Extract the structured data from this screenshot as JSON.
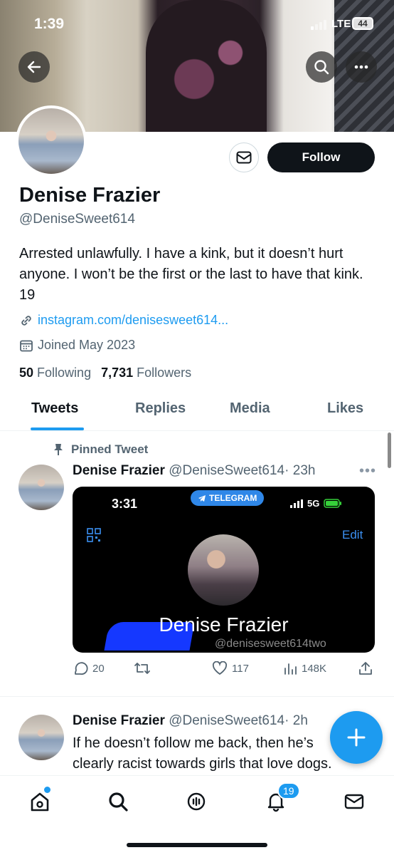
{
  "status_bar": {
    "time": "1:39",
    "network": "LTE",
    "battery": "44"
  },
  "profile": {
    "name": "Denise Frazier",
    "handle": "@DeniseSweet614",
    "bio": "Arrested unlawfully. I have a kink, but it doesn’t hurt anyone. I won’t be the first or the last to have that kink. 19",
    "link": "instagram.com/denisesweet614...",
    "joined": "Joined May 2023",
    "following_count": "50",
    "following_label": "Following",
    "followers_count": "7,731",
    "followers_label": "Followers",
    "follow_button": "Follow"
  },
  "tabs": [
    {
      "label": "Tweets",
      "active": true
    },
    {
      "label": "Replies"
    },
    {
      "label": "Media"
    },
    {
      "label": "Likes"
    }
  ],
  "tweets": [
    {
      "pinned_label": "Pinned Tweet",
      "name": "Denise Frazier",
      "handle": "@DeniseSweet614",
      "time": "· 23h",
      "media": {
        "time": "3:31",
        "app_label": "TELEGRAM",
        "network": "5G",
        "edit": "Edit",
        "name": "Denise Frazier",
        "handle": "@denisesweet614two"
      },
      "replies": "20",
      "likes": "117",
      "views": "148K"
    },
    {
      "name": "Denise Frazier",
      "handle": "@DeniseSweet614",
      "time": "· 2h",
      "text": "If he doesn’t follow me back, then he’s clearly racist towards girls that love dogs."
    }
  ],
  "nav": {
    "notifications_badge": "19"
  },
  "colors": {
    "accent": "#1d9bf0",
    "text": "#0f1419",
    "muted": "#536471"
  }
}
